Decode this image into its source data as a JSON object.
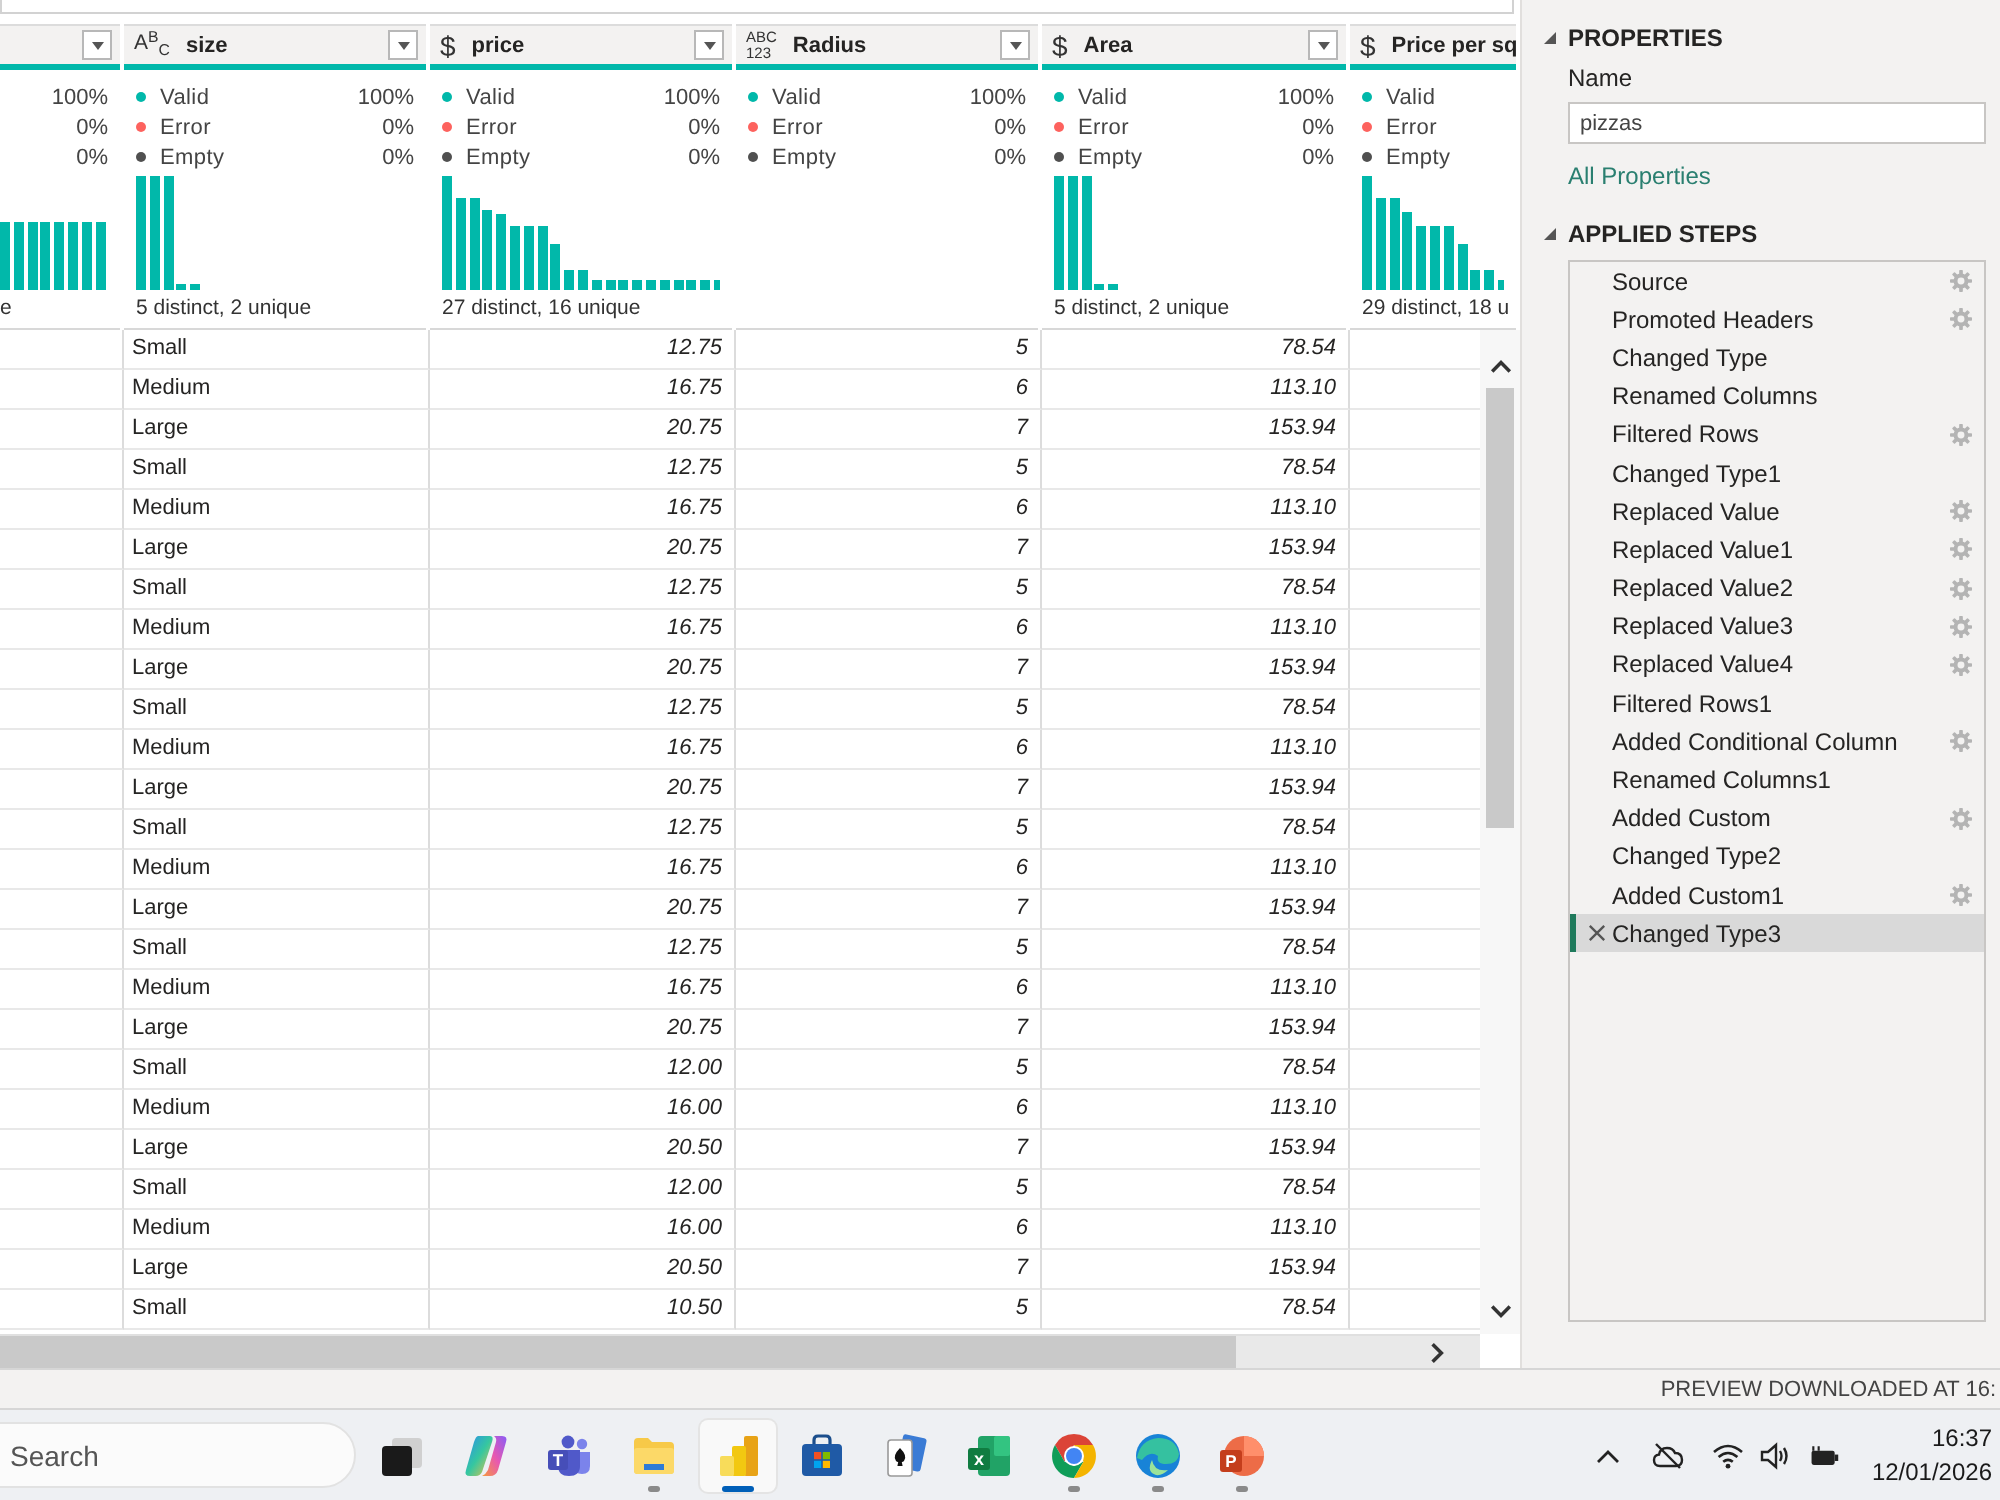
{
  "table": {
    "columns": [
      {
        "dropdown": true,
        "quality": [
          {
            "value": "100%"
          },
          {
            "value": "0%"
          },
          {
            "value": "0%"
          }
        ],
        "histogram": true,
        "footer": "e"
      },
      {
        "header": "size",
        "kind": "text",
        "type_icon": [
          "A$^{B}$$_{C}$"
        ],
        "dropdown": true,
        "quality": [
          {
            "label": "Valid",
            "value": "100%",
            "color": "#01b8aa"
          },
          {
            "label": "Error",
            "value": "0%",
            "color": "#fd625e"
          },
          {
            "label": "Empty",
            "value": "0%",
            "color": "#505050"
          }
        ],
        "histogram": true,
        "footer": "5 distinct, 2 unique",
        "cells": [
          "Small",
          "Medium",
          "Large",
          "Small",
          "Medium",
          "Large",
          "Small",
          "Medium",
          "Large",
          "Small",
          "Medium",
          "Large",
          "Small",
          "Medium",
          "Large",
          "Small",
          "Medium",
          "Large",
          "Small",
          "Medium",
          "Large",
          "Small",
          "Medium",
          "Large",
          "Small"
        ]
      },
      {
        "header": "price",
        "kind": "currency",
        "type_icon": [
          "$"
        ],
        "dropdown": true,
        "quality": [
          {
            "label": "Valid",
            "value": "100%",
            "color": "#01b8aa"
          },
          {
            "label": "Error",
            "value": "0%",
            "color": "#fd625e"
          },
          {
            "label": "Empty",
            "value": "0%",
            "color": "#505050"
          }
        ],
        "histogram": true,
        "footer": "27 distinct, 16 unique",
        "cells": [
          "12.75",
          "16.75",
          "20.75",
          "12.75",
          "16.75",
          "20.75",
          "12.75",
          "16.75",
          "20.75",
          "12.75",
          "16.75",
          "20.75",
          "12.75",
          "16.75",
          "20.75",
          "12.75",
          "16.75",
          "20.75",
          "12.00",
          "16.00",
          "20.50",
          "12.00",
          "16.00",
          "20.50",
          "10.50"
        ]
      },
      {
        "header": "Radius",
        "kind": "any",
        "type_icon": [
          "ABC",
          "123"
        ],
        "dropdown": true,
        "quality": [
          {
            "label": "Valid",
            "value": "100%",
            "color": "#01b8aa"
          },
          {
            "label": "Error",
            "value": "0%",
            "color": "#fd625e"
          },
          {
            "label": "Empty",
            "value": "0%",
            "color": "#505050"
          }
        ],
        "histogram": false,
        "cells": [
          "5",
          "6",
          "7",
          "5",
          "6",
          "7",
          "5",
          "6",
          "7",
          "5",
          "6",
          "7",
          "5",
          "6",
          "7",
          "5",
          "6",
          "7",
          "5",
          "6",
          "7",
          "5",
          "6",
          "7",
          "5"
        ]
      },
      {
        "header": "Area",
        "kind": "currency",
        "type_icon": [
          "$"
        ],
        "dropdown": true,
        "quality": [
          {
            "label": "Valid",
            "value": "100%",
            "color": "#01b8aa"
          },
          {
            "label": "Error",
            "value": "0%",
            "color": "#fd625e"
          },
          {
            "label": "Empty",
            "value": "0%",
            "color": "#505050"
          }
        ],
        "histogram": true,
        "footer": "5 distinct, 2 unique",
        "cells": [
          "78.54",
          "113.10",
          "153.94",
          "78.54",
          "113.10",
          "153.94",
          "78.54",
          "113.10",
          "153.94",
          "78.54",
          "113.10",
          "153.94",
          "78.54",
          "113.10",
          "153.94",
          "78.54",
          "113.10",
          "153.94",
          "78.54",
          "113.10",
          "153.94",
          "78.54",
          "113.10",
          "153.94",
          "78.54"
        ]
      },
      {
        "header": "Price per sq",
        "kind": "currency",
        "type_icon": [
          "$"
        ],
        "dropdown": false,
        "quality": [
          {
            "label": "Valid",
            "color": "#01b8aa"
          },
          {
            "label": "Error",
            "color": "#fd625e"
          },
          {
            "label": "Empty",
            "color": "#505050"
          }
        ],
        "histogram": true,
        "footer": "29 distinct, 18 u"
      }
    ]
  },
  "properties": {
    "title": "PROPERTIES",
    "name_label": "Name",
    "name_value": "pizzas",
    "link": "All Properties"
  },
  "applied_steps": {
    "title": "APPLIED STEPS",
    "steps": [
      {
        "label": "Source",
        "settings": true,
        "selected": false
      },
      {
        "label": "Promoted Headers",
        "settings": true,
        "selected": false
      },
      {
        "label": "Changed Type",
        "settings": false,
        "selected": false
      },
      {
        "label": "Renamed Columns",
        "settings": false,
        "selected": false
      },
      {
        "label": "Filtered Rows",
        "settings": true,
        "selected": false
      },
      {
        "label": "Changed Type1",
        "settings": false,
        "selected": false
      },
      {
        "label": "Replaced Value",
        "settings": true,
        "selected": false
      },
      {
        "label": "Replaced Value1",
        "settings": true,
        "selected": false
      },
      {
        "label": "Replaced Value2",
        "settings": true,
        "selected": false
      },
      {
        "label": "Replaced Value3",
        "settings": true,
        "selected": false
      },
      {
        "label": "Replaced Value4",
        "settings": true,
        "selected": false
      },
      {
        "label": "Filtered Rows1",
        "settings": false,
        "selected": false
      },
      {
        "label": "Added Conditional Column",
        "settings": true,
        "selected": false
      },
      {
        "label": "Renamed Columns1",
        "settings": false,
        "selected": false
      },
      {
        "label": "Added Custom",
        "settings": true,
        "selected": false
      },
      {
        "label": "Changed Type2",
        "settings": false,
        "selected": false
      },
      {
        "label": "Added Custom1",
        "settings": true,
        "selected": false
      },
      {
        "label": "Changed Type3",
        "settings": false,
        "selected": true
      }
    ]
  },
  "status_bar": {
    "text": "PREVIEW DOWNLOADED AT 16:"
  },
  "taskbar": {
    "search": {
      "placeholder": "Search"
    },
    "apps": [
      {
        "kind": "task-view",
        "running": false,
        "selected": false
      },
      {
        "kind": "swirl",
        "running": false,
        "selected": false
      },
      {
        "kind": "people",
        "letter": "T",
        "running": false,
        "selected": false
      },
      {
        "kind": "folder",
        "running": true,
        "selected": false
      },
      {
        "kind": "bar-chart",
        "running": true,
        "selected": true
      },
      {
        "kind": "bag",
        "running": false,
        "selected": false
      },
      {
        "kind": "cards",
        "running": false,
        "selected": false
      },
      {
        "kind": "spreadsheet",
        "letter": "x",
        "running": false,
        "selected": false
      },
      {
        "kind": "ring",
        "running": true,
        "selected": false
      },
      {
        "kind": "wave",
        "running": true,
        "selected": false
      },
      {
        "kind": "slides",
        "letter": "P",
        "running": true,
        "selected": false
      }
    ],
    "clock": {
      "time": "16:37",
      "date": "12/01/2026"
    }
  }
}
